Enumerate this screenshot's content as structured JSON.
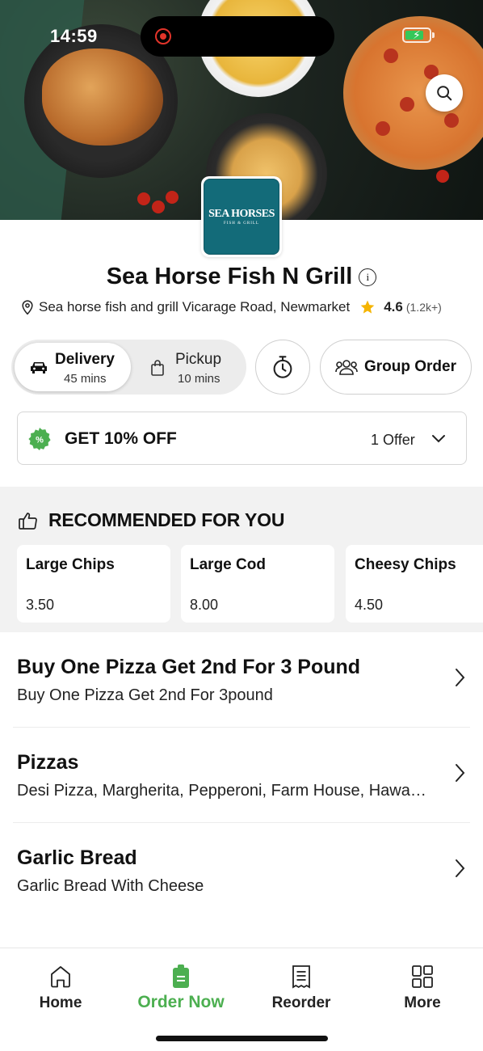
{
  "status_bar": {
    "time": "14:59"
  },
  "restaurant": {
    "logo_text": "SEA HORSES",
    "logo_subtext": "FISH & GRILL",
    "name": "Sea Horse Fish N Grill",
    "info_glyph": "i",
    "address": "Sea horse fish and grill Vicarage Road, Newmarket",
    "rating": "4.6",
    "rating_count": "(1.2k+)"
  },
  "modes": {
    "delivery": {
      "label": "Delivery",
      "time": "45 mins",
      "selected": true
    },
    "pickup": {
      "label": "Pickup",
      "time": "10 mins",
      "selected": false
    },
    "group_order_label": "Group Order"
  },
  "offer": {
    "badge_glyph": "%",
    "text": "GET 10% OFF",
    "count": "1 Offer"
  },
  "recommended": {
    "title": "RECOMMENDED FOR YOU",
    "items": [
      {
        "name": "Large Chips",
        "price": "3.50"
      },
      {
        "name": "Large Cod",
        "price": "8.00"
      },
      {
        "name": "Cheesy Chips",
        "price": "4.50"
      }
    ]
  },
  "categories": [
    {
      "name": "Buy One Pizza Get 2nd For 3 Pound",
      "desc": "Buy One Pizza Get 2nd For 3pound"
    },
    {
      "name": "Pizzas",
      "desc": "Desi Pizza, Margherita, Pepperoni, Farm House, Hawa…"
    },
    {
      "name": "Garlic Bread",
      "desc": "Garlic Bread With Cheese"
    }
  ],
  "bottom_nav": [
    {
      "label": "Home",
      "icon": "home-icon",
      "active": false
    },
    {
      "label": "Order Now",
      "icon": "order-icon",
      "active": true
    },
    {
      "label": "Reorder",
      "icon": "receipt-icon",
      "active": false
    },
    {
      "label": "More",
      "icon": "grid-icon",
      "active": false
    }
  ],
  "colors": {
    "accent": "#4caf50",
    "logo_bg": "#136b79",
    "star": "#f5b400",
    "recording": "#e2342a"
  }
}
